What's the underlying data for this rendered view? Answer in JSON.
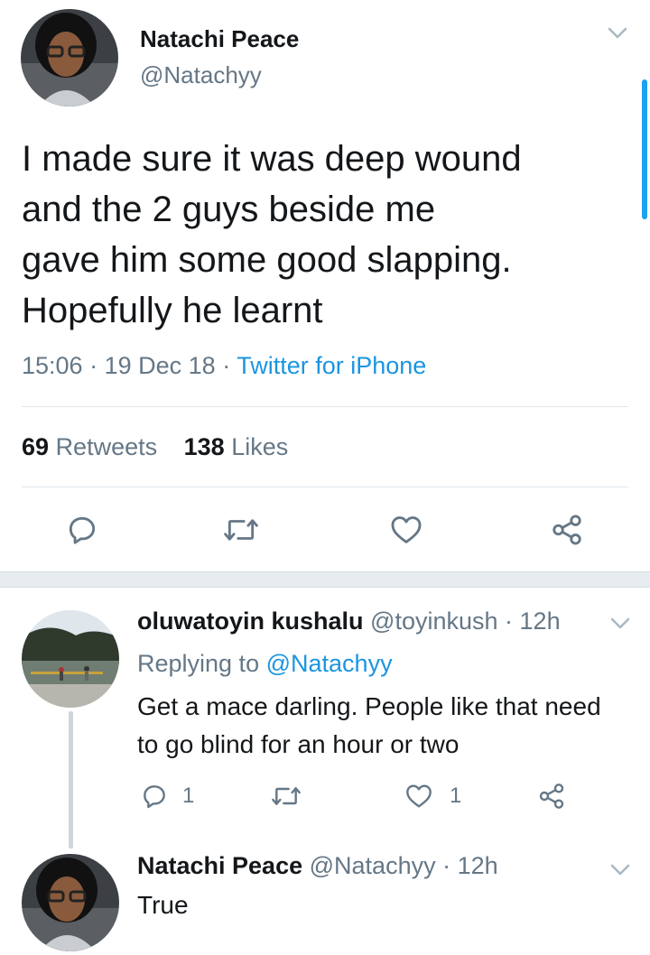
{
  "main_tweet": {
    "author_name": "Natachi Peace",
    "author_handle": "@Natachyy",
    "lines": [
      "I made sure it was deep wound",
      "and the 2 guys beside me",
      "gave him some good slapping.",
      "Hopefully he learnt"
    ],
    "time": "15:06",
    "sep": "·",
    "date": "19 Dec 18",
    "source": "Twitter for iPhone",
    "retweets_count": "69",
    "retweets_label": "Retweets",
    "likes_count": "138",
    "likes_label": "Likes",
    "actions": [
      "reply-icon",
      "retweet-icon",
      "like-icon",
      "share-icon"
    ]
  },
  "replies": [
    {
      "author_name": "oluwatoyin kushalu",
      "author_handle": "@toyinkush",
      "time": "· 12h",
      "replying_prefix": "Replying to",
      "replying_to": "@Natachyy",
      "text_lines": [
        "Get a mace darling. People like that need",
        "to go blind for an hour or two"
      ],
      "reply_count": "1",
      "like_count": "1"
    },
    {
      "author_name": "Natachi Peace",
      "author_handle": "@Natachyy",
      "time": "· 12h",
      "text": "True"
    }
  ],
  "colors": {
    "accent": "#1b95e0",
    "text": "#14171a",
    "muted": "#657786",
    "divider": "#e1e8ed",
    "scrollbar": "#1da1f2"
  }
}
